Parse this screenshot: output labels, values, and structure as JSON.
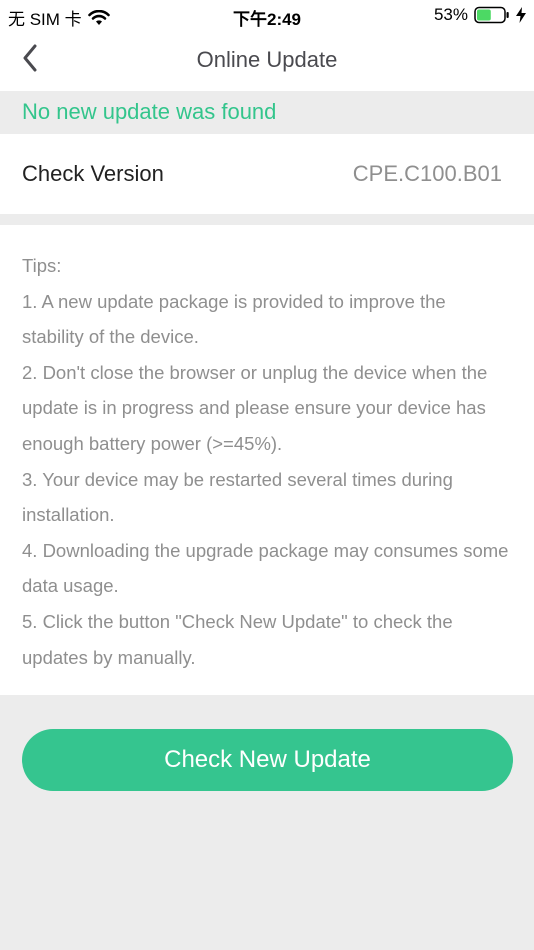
{
  "status_bar": {
    "carrier": "无 SIM 卡",
    "time": "下午2:49",
    "battery_percent_text": "53%",
    "battery_level": 0.53,
    "icons": [
      "wifi-icon",
      "battery-icon",
      "charging-bolt-icon"
    ]
  },
  "nav": {
    "title": "Online Update",
    "back_icon": "chevron-left-icon"
  },
  "notice": {
    "text": "No new update was found",
    "color": "#33c58c"
  },
  "version": {
    "label": "Check Version",
    "value": "CPE.C100.B01"
  },
  "tips": {
    "heading": "Tips:",
    "items": [
      "1. A new update package is provided to improve the stability of the device.",
      "2. Don't close the browser or unplug the device when the update is in progress and please ensure your device has enough battery power (>=45%).",
      "3. Your device may be restarted several times during installation.",
      "4. Downloading the upgrade package may consumes some data usage.",
      "5. Click the button \"Check New Update\" to check the updates by manually."
    ]
  },
  "button": {
    "label": "Check New Update",
    "color": "#35c58f"
  }
}
